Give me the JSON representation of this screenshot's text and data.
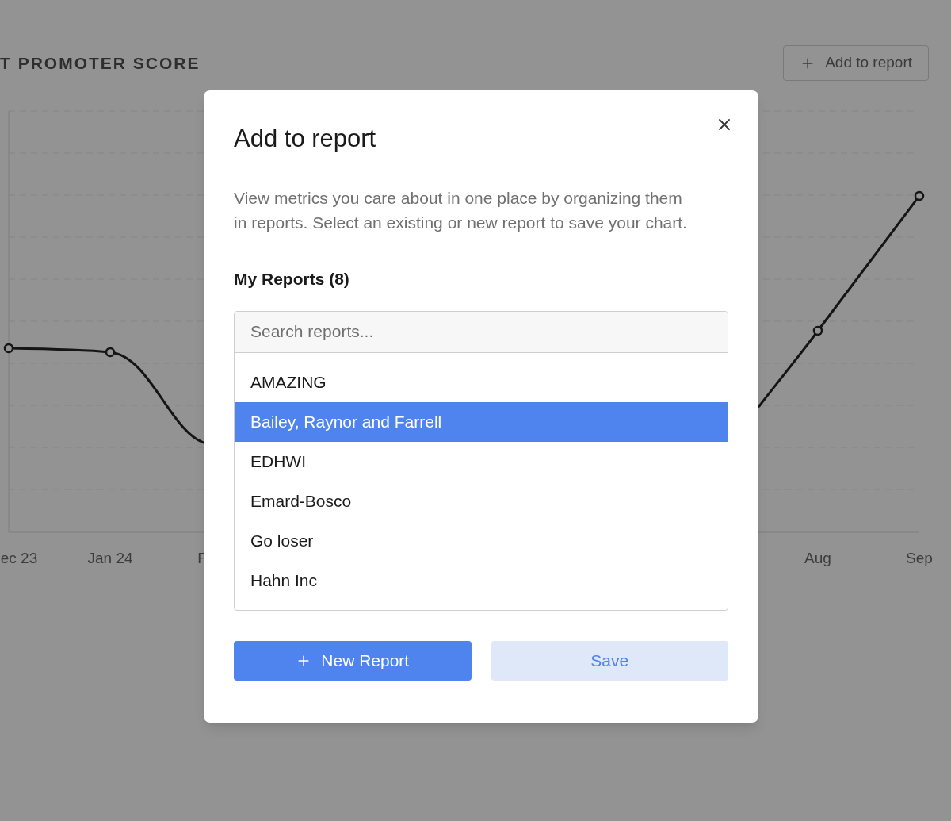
{
  "page": {
    "title": "T PROMOTER SCORE",
    "add_button": "Add to report",
    "chart_x_labels": [
      "ec 23",
      "Jan 24",
      "F",
      "Aug",
      "Sep"
    ]
  },
  "dialog": {
    "title": "Add to report",
    "description": "View metrics you care about in one place by organizing them in reports. Select an existing or new report to save your chart.",
    "section_title": "My Reports (8)",
    "search": {
      "placeholder": "Search reports..."
    },
    "reports": [
      {
        "name": "AMAZING",
        "selected": false
      },
      {
        "name": "Bailey, Raynor and Farrell",
        "selected": true
      },
      {
        "name": "EDHWI",
        "selected": false
      },
      {
        "name": "Emard-Bosco",
        "selected": false
      },
      {
        "name": "Go loser",
        "selected": false
      },
      {
        "name": "Hahn Inc",
        "selected": false
      }
    ],
    "buttons": [
      {
        "label": "New Report",
        "kind": "primary"
      },
      {
        "label": "Save",
        "kind": "secondary"
      }
    ]
  }
}
